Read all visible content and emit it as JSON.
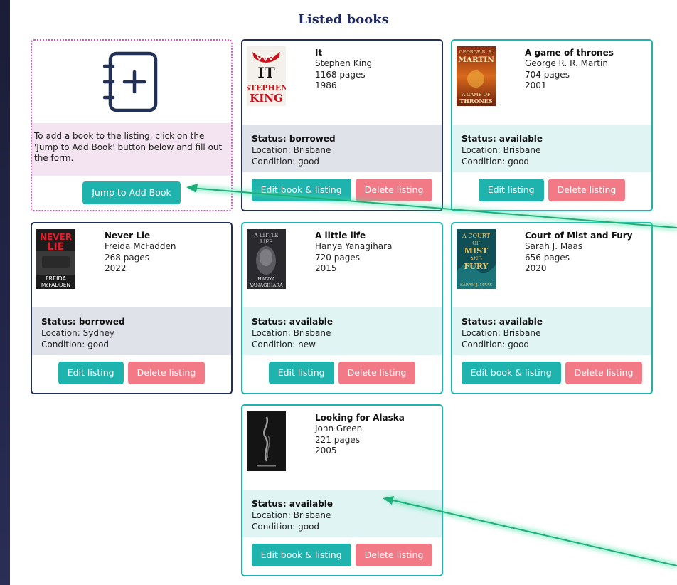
{
  "page_title": "Listed books",
  "add_card": {
    "instructions": "To add a book to the listing, click on the 'Jump to Add Book' button below and fill out the form.",
    "button_label": "Jump to Add Book"
  },
  "books": [
    {
      "title": "It",
      "author": "Stephen King",
      "pages": "1168 pages",
      "year": "1986",
      "status": "Status: borrowed",
      "location": "Location: Brisbane",
      "condition": "Condition: good",
      "edit_label": "Edit book & listing",
      "delete_label": "Delete listing"
    },
    {
      "title": "A game of thrones",
      "author": "George R. R. Martin",
      "pages": "704 pages",
      "year": "2001",
      "status": "Status: available",
      "location": "Location: Brisbane",
      "condition": "Condition: good",
      "edit_label": "Edit listing",
      "delete_label": "Delete listing"
    },
    {
      "title": "Never Lie",
      "author": "Freida McFadden",
      "pages": "268 pages",
      "year": "2022",
      "status": "Status: borrowed",
      "location": "Location: Sydney",
      "condition": "Condition: good",
      "edit_label": "Edit listing",
      "delete_label": "Delete listing"
    },
    {
      "title": "A little life",
      "author": "Hanya Yanagihara",
      "pages": "720 pages",
      "year": "2015",
      "status": "Status: available",
      "location": "Location: Brisbane",
      "condition": "Condition: new",
      "edit_label": "Edit listing",
      "delete_label": "Delete listing"
    },
    {
      "title": "Court of Mist and Fury",
      "author": "Sarah J. Maas",
      "pages": "656 pages",
      "year": "2020",
      "status": "Status: available",
      "location": "Location: Brisbane",
      "condition": "Condition: good",
      "edit_label": "Edit book & listing",
      "delete_label": "Delete listing"
    },
    {
      "title": "Looking for Alaska",
      "author": "John Green",
      "pages": "221 pages",
      "year": "2005",
      "status": "Status: available",
      "location": "Location: Brisbane",
      "condition": "Condition: good",
      "edit_label": "Edit book & listing",
      "delete_label": "Delete listing"
    }
  ],
  "covers": {
    "it": {
      "line1": "IT",
      "line2": "STEPHEN",
      "line3": "KING"
    },
    "got": {
      "line1": "GEORGE R. R.",
      "line2": "MARTIN",
      "line3": "A GAME OF",
      "line4": "THRONES"
    },
    "never_lie": {
      "line1": "NEVER",
      "line2": "LIE",
      "line3": "FREIDA",
      "line4": "McFADDEN"
    },
    "little_life": {
      "line1": "A LITTLE",
      "line2": "LIFE",
      "line3": "HANYA",
      "line4": "YANAGIHARA"
    },
    "acomaf": {
      "line1": "A COURT",
      "line2": "OF",
      "line3": "MIST",
      "line4": "AND",
      "line5": "FURY",
      "line6": "SARAH J. MAAS"
    }
  },
  "colors": {
    "accent": "#1fb3ae",
    "delete": "#f27a87",
    "borrowed_border": "#223055",
    "add_border": "#e14fcf",
    "annotation_arrow": "#1fae7a"
  }
}
